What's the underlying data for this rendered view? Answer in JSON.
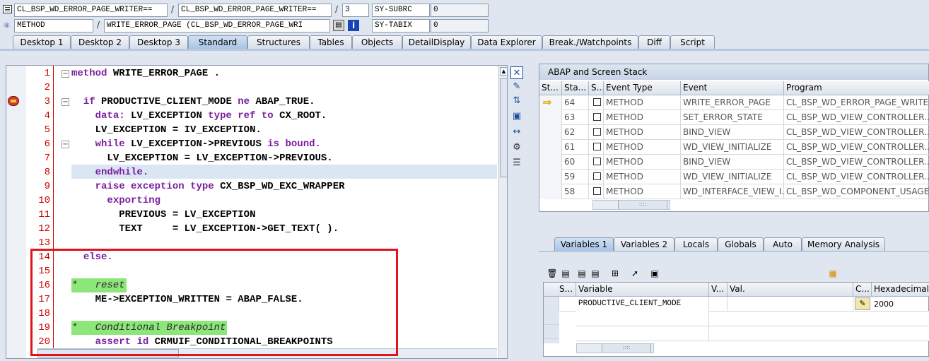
{
  "header": {
    "row1": {
      "class_field": "CL_BSP_WD_ERROR_PAGE_WRITER==",
      "class_field2": "CL_BSP_WD_ERROR_PAGE_WRITER==",
      "line_field": "3",
      "sysvar_name": "SY-SUBRC",
      "sysvar_value": "0"
    },
    "row2": {
      "type_field": "METHOD",
      "method_field": "WRITE_ERROR_PAGE (CL_BSP_WD_ERROR_PAGE_WRI",
      "sysvar_name": "SY-TABIX",
      "sysvar_value": "0"
    },
    "sep": "/"
  },
  "tabs": [
    "Desktop 1",
    "Desktop 2",
    "Desktop 3",
    "Standard",
    "Structures",
    "Tables",
    "Objects",
    "DetailDisplay",
    "Data Explorer",
    "Break./Watchpoints",
    "Diff",
    "Script"
  ],
  "active_tab": "Standard",
  "editor": {
    "lines": [
      {
        "n": "1",
        "text": "method WRITE_ERROR_PAGE ."
      },
      {
        "n": "2",
        "text": ""
      },
      {
        "n": "3",
        "text": "  if PRODUCTIVE_CLIENT_MODE ne ABAP_TRUE."
      },
      {
        "n": "4",
        "text": "    data: LV_EXCEPTION type ref to CX_ROOT."
      },
      {
        "n": "5",
        "text": "    LV_EXCEPTION = IV_EXCEPTION."
      },
      {
        "n": "6",
        "text": "    while LV_EXCEPTION->PREVIOUS is bound."
      },
      {
        "n": "7",
        "text": "      LV_EXCEPTION = LV_EXCEPTION->PREVIOUS."
      },
      {
        "n": "8",
        "text": "    endwhile."
      },
      {
        "n": "9",
        "text": "    raise exception type CX_BSP_WD_EXC_WRAPPER"
      },
      {
        "n": "10",
        "text": "      exporting"
      },
      {
        "n": "11",
        "text": "        PREVIOUS = LV_EXCEPTION"
      },
      {
        "n": "12",
        "text": "        TEXT     = LV_EXCEPTION->GET_TEXT( )."
      },
      {
        "n": "13",
        "text": ""
      },
      {
        "n": "14",
        "text": "  else."
      },
      {
        "n": "15",
        "text": ""
      },
      {
        "n": "16",
        "text": "*   reset"
      },
      {
        "n": "17",
        "text": "    ME->EXCEPTION_WRITTEN = ABAP_FALSE."
      },
      {
        "n": "18",
        "text": ""
      },
      {
        "n": "19",
        "text": "*   Conditional Breakpoint"
      },
      {
        "n": "20",
        "text": "    assert id CRMUIF_CONDITIONAL_BREAKPOINTS"
      }
    ]
  },
  "stack": {
    "title": "ABAP and Screen Stack",
    "columns": [
      "St...",
      "Sta...",
      "S...",
      "Event Type",
      "Event",
      "Program"
    ],
    "rows": [
      {
        "stack": "64",
        "type": "METHOD",
        "event": "WRITE_ERROR_PAGE",
        "program": "CL_BSP_WD_ERROR_PAGE_WRITE..."
      },
      {
        "stack": "63",
        "type": "METHOD",
        "event": "SET_ERROR_STATE",
        "program": "CL_BSP_WD_VIEW_CONTROLLER..."
      },
      {
        "stack": "62",
        "type": "METHOD",
        "event": "BIND_VIEW",
        "program": "CL_BSP_WD_VIEW_CONTROLLER..."
      },
      {
        "stack": "61",
        "type": "METHOD",
        "event": "WD_VIEW_INITIALIZE",
        "program": "CL_BSP_WD_VIEW_CONTROLLER..."
      },
      {
        "stack": "60",
        "type": "METHOD",
        "event": "BIND_VIEW",
        "program": "CL_BSP_WD_VIEW_CONTROLLER..."
      },
      {
        "stack": "59",
        "type": "METHOD",
        "event": "WD_VIEW_INITIALIZE",
        "program": "CL_BSP_WD_VIEW_CONTROLLER..."
      },
      {
        "stack": "58",
        "type": "METHOD",
        "event": "WD_INTERFACE_VIEW_I...",
        "program": "CL_BSP_WD_COMPONENT_USAGE..."
      }
    ]
  },
  "var_tabs": [
    "Variables 1",
    "Variables 2",
    "Locals",
    "Globals",
    "Auto",
    "Memory Analysis"
  ],
  "active_var_tab": "Variables 1",
  "variables": {
    "columns": [
      "S...",
      "Variable",
      "V...",
      "Val.",
      "C...",
      "Hexadecimal V"
    ],
    "rows": [
      {
        "variable": "PRODUCTIVE_CLIENT_MODE",
        "value": "",
        "hex": "2000"
      }
    ]
  }
}
